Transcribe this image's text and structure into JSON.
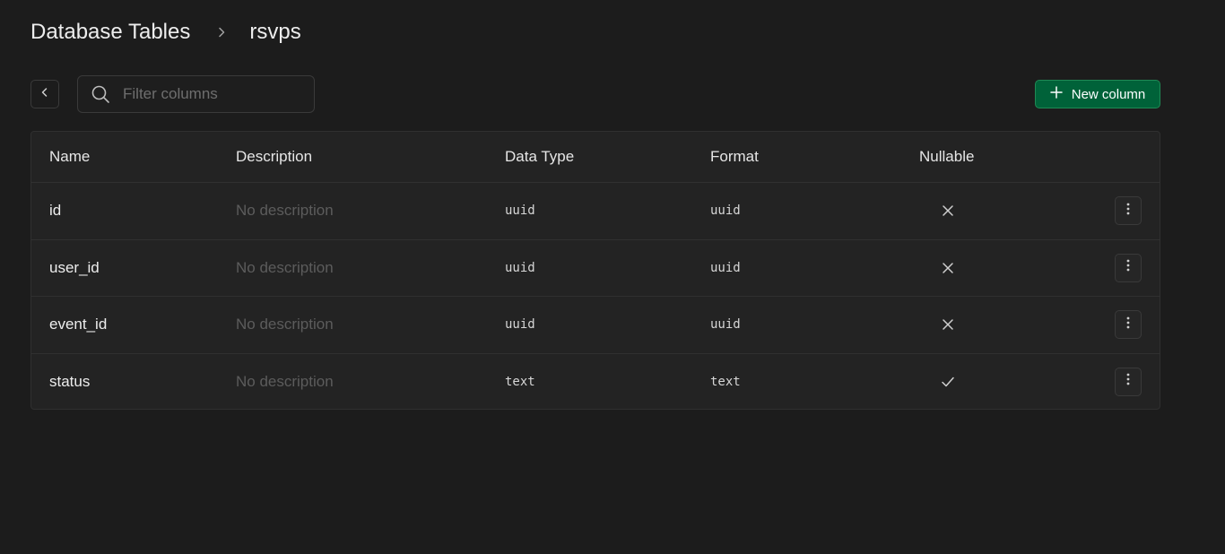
{
  "breadcrumb": {
    "root": "Database Tables",
    "current": "rsvps"
  },
  "toolbar": {
    "search_placeholder": "Filter columns",
    "new_column_label": "New column"
  },
  "table": {
    "headers": {
      "name": "Name",
      "description": "Description",
      "data_type": "Data Type",
      "format": "Format",
      "nullable": "Nullable"
    },
    "rows": [
      {
        "name": "id",
        "description": "No description",
        "data_type": "uuid",
        "format": "uuid",
        "nullable": false
      },
      {
        "name": "user_id",
        "description": "No description",
        "data_type": "uuid",
        "format": "uuid",
        "nullable": false
      },
      {
        "name": "event_id",
        "description": "No description",
        "data_type": "uuid",
        "format": "uuid",
        "nullable": false
      },
      {
        "name": "status",
        "description": "No description",
        "data_type": "text",
        "format": "text",
        "nullable": true
      }
    ]
  },
  "icons": {
    "breadcrumb_separator": "chevron-right-icon",
    "back": "chevron-left-icon",
    "search": "search-icon",
    "new_column": "plus-icon",
    "not_nullable": "x-icon",
    "nullable": "check-icon",
    "row_menu": "more-vertical-icon"
  },
  "colors": {
    "background": "#1c1c1c",
    "primary_button": "#006239"
  }
}
